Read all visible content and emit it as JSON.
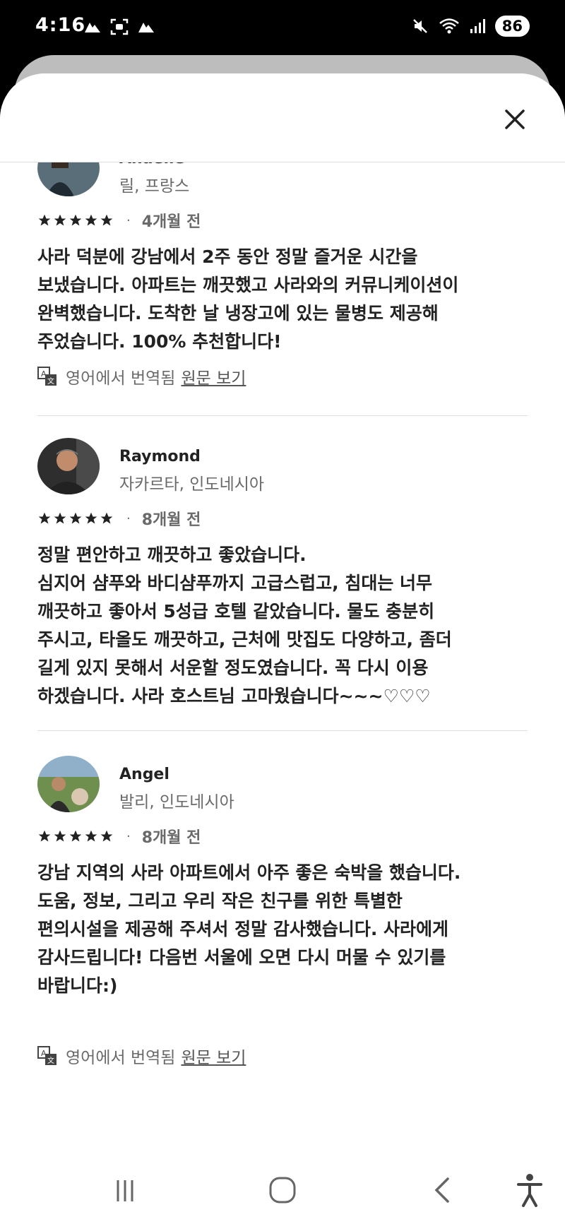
{
  "status_bar": {
    "time": "4:16",
    "battery": "86",
    "left_icons": [
      "cloud-icon",
      "face-scan-icon",
      "cloud-icon"
    ],
    "right_icons": [
      "mute-icon",
      "wifi-icon",
      "signal-icon"
    ]
  },
  "reviews": [
    {
      "name": "Anaelle",
      "location": "릴, 프랑스",
      "rating": 5,
      "time_ago": "4개월 전",
      "text": "사라 덕분에 강남에서 2주 동안 정말 즐거운 시간을\n보냈습니다. 아파트는 깨끗했고 사라와의 커뮤니케이션이\n완벽했습니다. 도착한 날 냉장고에 있는 물병도 제공해\n주었습니다. 100% 추천합니다!",
      "translation_note": "영어에서 번역됨",
      "translation_link": "원문 보기"
    },
    {
      "name": "Raymond",
      "location": "자카르타, 인도네시아",
      "rating": 5,
      "time_ago": "8개월 전",
      "text": "정말 편안하고 깨끗하고 좋았습니다.\n심지어 샴푸와 바디샴푸까지 고급스럽고, 침대는 너무\n깨끗하고 좋아서 5성급 호텔 같았습니다. 물도 충분히\n주시고, 타올도 깨끗하고, 근처에 맛집도 다양하고, 좀더\n길게 있지 못해서 서운할 정도였습니다. 꼭 다시 이용\n하겠습니다. 사라 호스트님 고마웠습니다~~~♡♡♡"
    },
    {
      "name": "Angel",
      "location": "발리, 인도네시아",
      "rating": 5,
      "time_ago": "8개월 전",
      "text": "강남 지역의 사라 아파트에서 아주 좋은 숙박을 했습니다.\n도움, 정보, 그리고 우리 작은 친구를 위한 특별한\n편의시설을 제공해 주셔서 정말 감사했습니다. 사라에게\n감사드립니다! 다음번 서울에 오면 다시 머물 수 있기를\n바랍니다:)",
      "translation_note": "영어에서 번역됨",
      "translation_link": "원문 보기"
    }
  ],
  "nav_bar": {
    "buttons": [
      "recent-apps",
      "home",
      "back",
      "accessibility"
    ]
  }
}
